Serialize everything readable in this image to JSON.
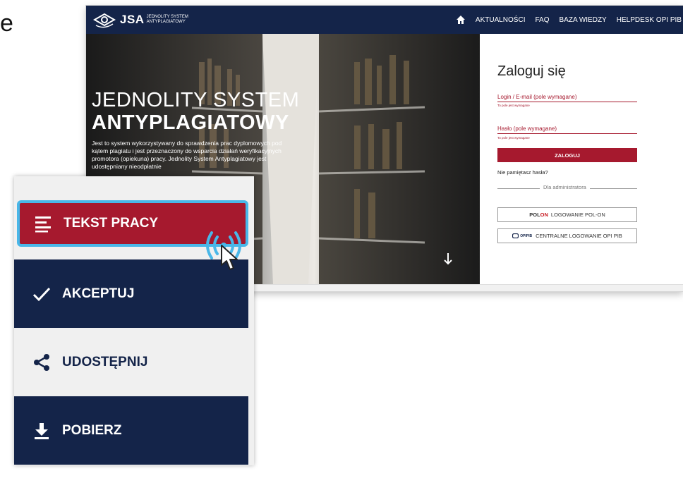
{
  "fragment_text": "e",
  "site": {
    "logo": {
      "short": "JSA",
      "sub_line1": "JEDNOLITY SYSTEM",
      "sub_line2": "ANTYPLAGIATOWY"
    },
    "nav": [
      "AKTUALNOŚCI",
      "FAQ",
      "BAZA WIEDZY",
      "HELPDESK OPI PIB"
    ],
    "hero": {
      "title_line1": "JEDNOLITY SYSTEM",
      "title_line2": "ANTYPLAGIATOWY",
      "description": "Jest to system wykorzystywany do sprawdzenia prac dyplomowych pod kątem plagiatu i jest przeznaczony do wsparcia działań weryfikacyjnych promotora (opiekuna) pracy. Jednolity System Antyplagiatowy jest udostępniany nieodpłatnie"
    },
    "login": {
      "title": "Zaloguj się",
      "login_label": "Login / E-mail (pole wymagane)",
      "login_error": "To pole jest wymagane",
      "password_label": "Hasło (pole wymagane)",
      "password_error": "To pole jest wymagane",
      "submit": "ZALOGUJ",
      "forgot": "Nie pamiętasz hasła?",
      "admin_divider": "Dla administratora",
      "polon_logo_a": "POL",
      "polon_logo_b": "ON",
      "polon_button": "LOGOWANIE POL-ON",
      "opi_logo": "OPIPIB",
      "opi_button": "CENTRALNE LOGOWANIE OPI PIB"
    }
  },
  "menu": {
    "items": [
      {
        "label": "TEKST PRACY",
        "icon": "text-lines-icon",
        "state": "highlighted"
      },
      {
        "label": "AKCEPTUJ",
        "icon": "checkmark-icon"
      },
      {
        "label": "UDOSTĘPNIJ",
        "icon": "share-icon"
      },
      {
        "label": "POBIERZ",
        "icon": "download-icon"
      }
    ]
  },
  "colors": {
    "navy": "#142449",
    "crimson": "#a6192e",
    "focus_ring": "#49b7e8",
    "menu_bg": "#f0f0f0"
  }
}
